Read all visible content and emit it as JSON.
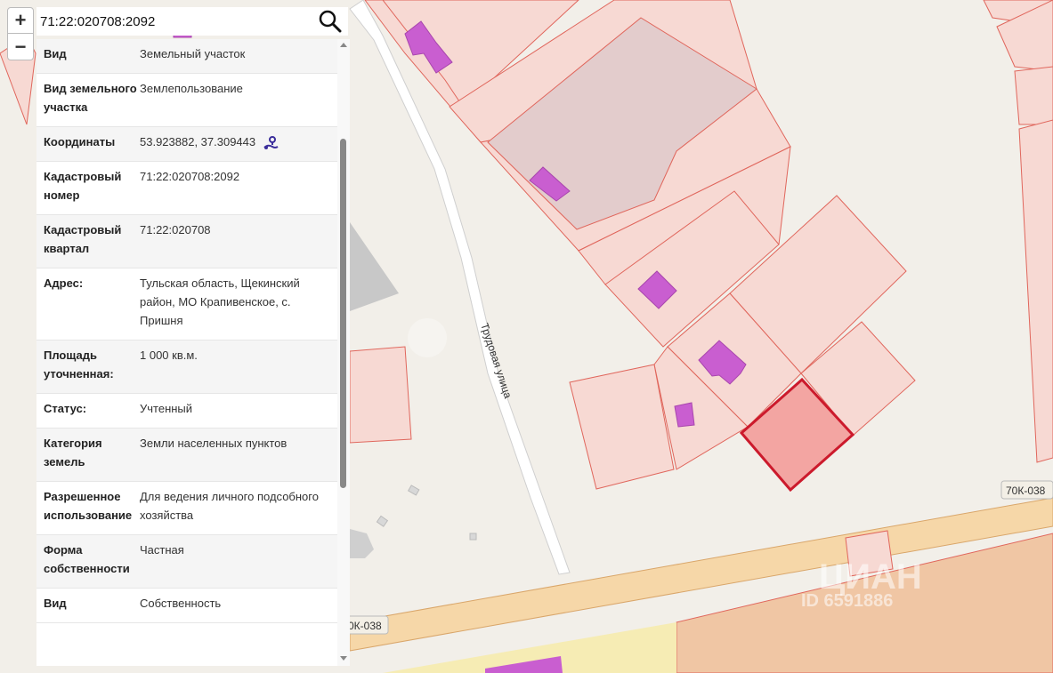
{
  "map": {
    "street_name": "Трудовая улица",
    "road_code_right": "70К-038",
    "road_code_left": "0К-038",
    "watermark_brand": "ЦИАН",
    "watermark_id": "ID 6591886",
    "colors": {
      "parcel_fill": "#f7d9d3",
      "parcel_stroke": "#e0665c",
      "building": "#c95ed0",
      "selected_fill": "#f3a5a2",
      "selected_stroke": "#cc1a2c",
      "road": "#f6d7a8"
    }
  },
  "controls": {
    "zoom_in": "+",
    "zoom_out": "−",
    "search_icon": "magnifier-icon"
  },
  "search": {
    "value": "71:22:020708:2092"
  },
  "info": [
    {
      "key": "Вид",
      "value": "Земельный участок"
    },
    {
      "key": "Вид земельного участка",
      "value": "Землепользование"
    },
    {
      "key": "Координаты",
      "value": "53.923882, 37.309443"
    },
    {
      "key": "Кадастровый номер",
      "value": "71:22:020708:2092"
    },
    {
      "key": "Кадастровый квартал",
      "value": "71:22:020708"
    },
    {
      "key": "Адрес:",
      "value": "Тульская область, Щекинский район, МО Крапивенское, с. Пришня"
    },
    {
      "key": "Площадь уточненная:",
      "value": "1 000 кв.м."
    },
    {
      "key": "Статус:",
      "value": "Учтенный"
    },
    {
      "key": "Категория земель",
      "value": "Земли населенных пунктов"
    },
    {
      "key": "Разрешенное использование",
      "value": "Для ведения личного подсобного хозяйства"
    },
    {
      "key": "Форма собственности",
      "value": "Частная"
    },
    {
      "key": "Вид",
      "value": "Собственность"
    }
  ]
}
